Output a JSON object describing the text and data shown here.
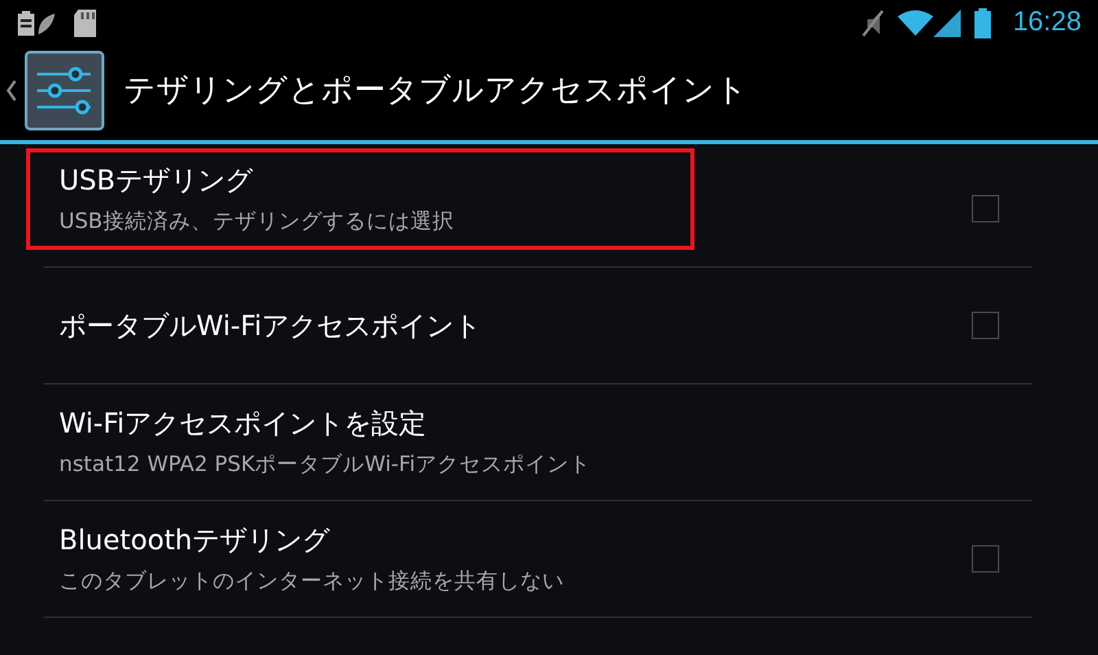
{
  "status_bar": {
    "time": "16:28"
  },
  "action_bar": {
    "title": "テザリングとポータブルアクセスポイント"
  },
  "items": [
    {
      "kind": "checkbox",
      "title": "USBテザリング",
      "summary": "USB接続済み、テザリングするには選択",
      "checked": false,
      "highlighted": true
    },
    {
      "kind": "checkbox",
      "title": "ポータブルWi-Fiアクセスポイント",
      "checked": false,
      "highlighted": false
    },
    {
      "kind": "link",
      "title": "Wi-Fiアクセスポイントを設定",
      "summary": "nstat12 WPA2 PSKポータブルWi-Fiアクセスポイント",
      "highlighted": false
    },
    {
      "kind": "checkbox",
      "title": "Bluetoothテザリング",
      "summary": "このタブレットのインターネット接続を共有しない",
      "checked": false,
      "highlighted": false
    }
  ]
}
